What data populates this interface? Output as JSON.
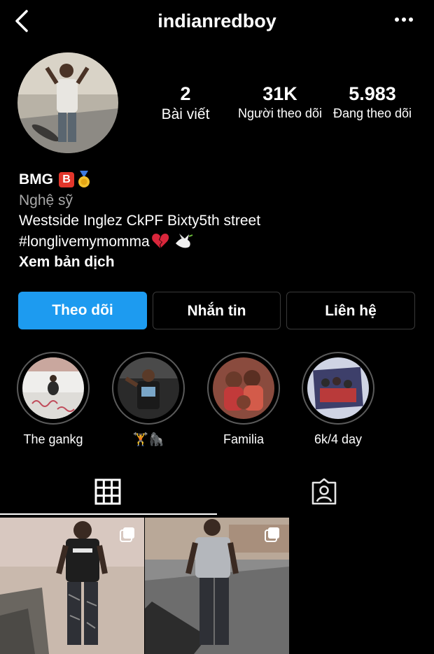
{
  "header": {
    "username": "indianredboy",
    "back_icon": "chevron-left-icon",
    "more_icon": "more-horizontal-icon"
  },
  "profile": {
    "stats": [
      {
        "value": "2",
        "label": "Bài viết"
      },
      {
        "value": "31K",
        "label": "Người theo dõi"
      },
      {
        "value": "5.983",
        "label": "Đang theo dõi"
      }
    ]
  },
  "bio": {
    "name": "BMG",
    "badge_letter": "B",
    "category": "Nghệ sỹ",
    "line1": "Westside Inglez CkPF Bixty5th street",
    "line2": "#longlivemymomma",
    "translate": "Xem bản dịch"
  },
  "actions": {
    "follow": "Theo dõi",
    "message": "Nhắn tin",
    "contact": "Liên hệ"
  },
  "highlights": [
    {
      "label": "The gankg"
    },
    {
      "label": "🏋🦍"
    },
    {
      "label": "Familia"
    },
    {
      "label": "6k/4 day"
    }
  ],
  "tabs": {
    "grid_icon": "grid-icon",
    "tagged_icon": "tagged-person-icon"
  },
  "colors": {
    "accent": "#1d9bf0",
    "background": "#000000",
    "secondary_text": "#a8a8a8"
  }
}
